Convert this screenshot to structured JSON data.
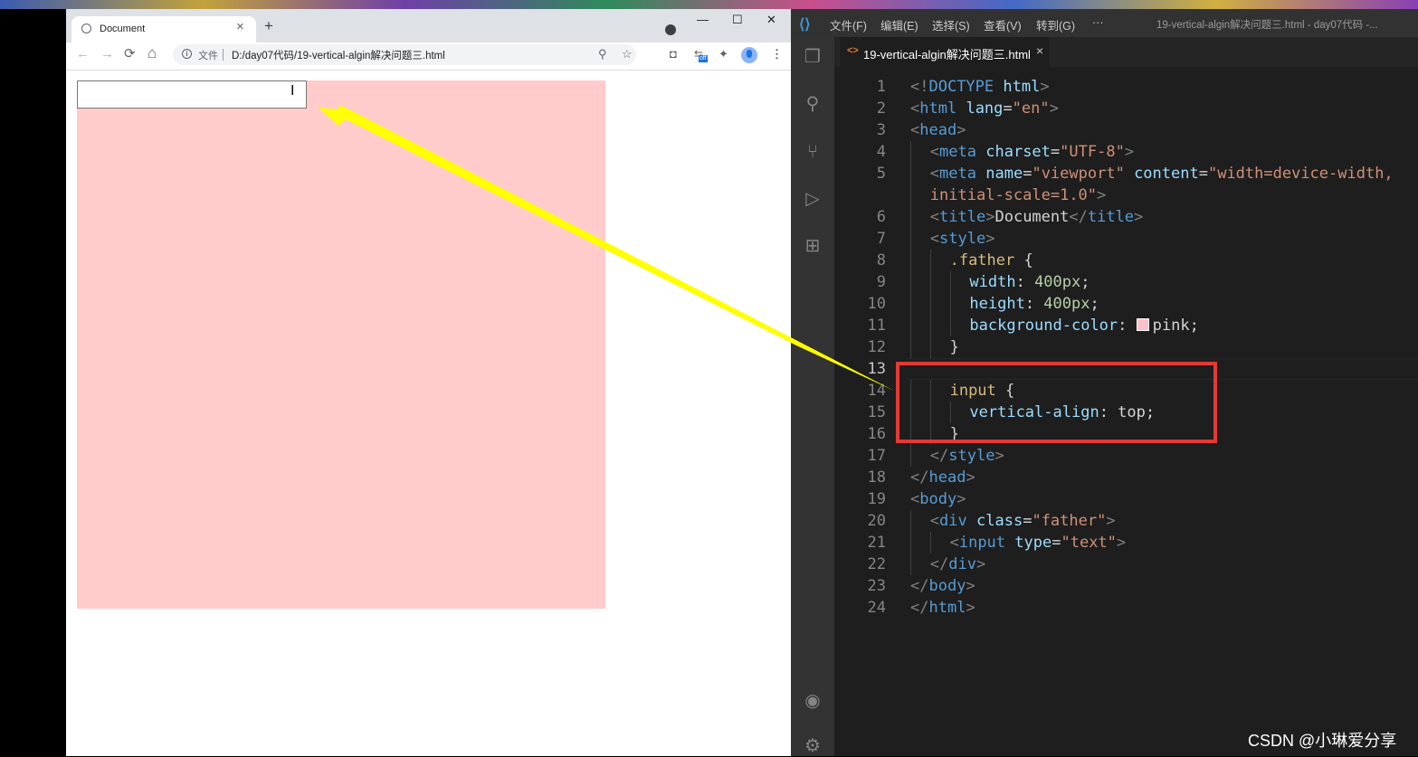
{
  "browser": {
    "tab_title": "Document",
    "tab_close": "×",
    "new_tab": "+",
    "minimize": "—",
    "maximize": "☐",
    "close": "✕",
    "back": "←",
    "forward": "→",
    "reload": "⟳",
    "home": "⌂",
    "info": "i",
    "file_label": "文件",
    "url": "D:/day07代码/19-vertical-algin解决问题三.html",
    "ext_off_badge": "off",
    "menu": "⋮",
    "page": {
      "father_color": "#ffcccb",
      "input_value": "",
      "cursor": "I"
    }
  },
  "vscode": {
    "menu": [
      "文件(F)",
      "编辑(E)",
      "选择(S)",
      "查看(V)",
      "转到(G)",
      "···"
    ],
    "window_title": "19-vertical-algin解决问题三.html - day07代码 -...",
    "tab_title": "19-vertical-algin解决问题三.html",
    "tab_icon": "<>",
    "tab_close": "×",
    "active_line": 13,
    "lines": [
      {
        "n": "1",
        "indent": 0,
        "tokens": [
          [
            "br",
            "<!"
          ],
          [
            "tag",
            "DOCTYPE"
          ],
          [
            "txt",
            " "
          ],
          [
            "attr",
            "html"
          ],
          [
            "br",
            ">"
          ]
        ]
      },
      {
        "n": "2",
        "indent": 0,
        "tokens": [
          [
            "br",
            "<"
          ],
          [
            "tag",
            "html"
          ],
          [
            "txt",
            " "
          ],
          [
            "attr",
            "lang"
          ],
          [
            "txt",
            "="
          ],
          [
            "str",
            "\"en\""
          ],
          [
            "br",
            ">"
          ]
        ]
      },
      {
        "n": "3",
        "indent": 0,
        "tokens": [
          [
            "br",
            "<"
          ],
          [
            "tag",
            "head"
          ],
          [
            "br",
            ">"
          ]
        ]
      },
      {
        "n": "4",
        "indent": 1,
        "tokens": [
          [
            "br",
            "<"
          ],
          [
            "tag",
            "meta"
          ],
          [
            "txt",
            " "
          ],
          [
            "attr",
            "charset"
          ],
          [
            "txt",
            "="
          ],
          [
            "str",
            "\"UTF-8\""
          ],
          [
            "br",
            ">"
          ]
        ]
      },
      {
        "n": "5",
        "indent": 1,
        "tokens": [
          [
            "br",
            "<"
          ],
          [
            "tag",
            "meta"
          ],
          [
            "txt",
            " "
          ],
          [
            "attr",
            "name"
          ],
          [
            "txt",
            "="
          ],
          [
            "str",
            "\"viewport\""
          ],
          [
            "txt",
            " "
          ],
          [
            "attr",
            "content"
          ],
          [
            "txt",
            "="
          ],
          [
            "str",
            "\"width=device-width,"
          ]
        ]
      },
      {
        "n": "",
        "indent": 1,
        "tokens": [
          [
            "str",
            "initial-scale=1.0\""
          ],
          [
            "br",
            ">"
          ]
        ]
      },
      {
        "n": "6",
        "indent": 1,
        "tokens": [
          [
            "br",
            "<"
          ],
          [
            "tag",
            "title"
          ],
          [
            "br",
            ">"
          ],
          [
            "txt",
            "Document"
          ],
          [
            "br",
            "</"
          ],
          [
            "tag",
            "title"
          ],
          [
            "br",
            ">"
          ]
        ]
      },
      {
        "n": "7",
        "indent": 1,
        "tokens": [
          [
            "br",
            "<"
          ],
          [
            "tag",
            "style"
          ],
          [
            "br",
            ">"
          ]
        ]
      },
      {
        "n": "8",
        "indent": 2,
        "tokens": [
          [
            "sel",
            ".father"
          ],
          [
            "txt",
            " {"
          ]
        ]
      },
      {
        "n": "9",
        "indent": 3,
        "tokens": [
          [
            "attr",
            "width"
          ],
          [
            "txt",
            ": "
          ],
          [
            "num",
            "400px"
          ],
          [
            "txt",
            ";"
          ]
        ]
      },
      {
        "n": "10",
        "indent": 3,
        "tokens": [
          [
            "attr",
            "height"
          ],
          [
            "txt",
            ": "
          ],
          [
            "num",
            "400px"
          ],
          [
            "txt",
            ";"
          ]
        ]
      },
      {
        "n": "11",
        "indent": 3,
        "tokens": [
          [
            "attr",
            "background-color"
          ],
          [
            "txt",
            ": "
          ],
          [
            "swatch",
            ""
          ],
          [
            "txt",
            "pink;"
          ]
        ]
      },
      {
        "n": "12",
        "indent": 2,
        "tokens": [
          [
            "txt",
            "}"
          ]
        ]
      },
      {
        "n": "13",
        "indent": 0,
        "tokens": []
      },
      {
        "n": "14",
        "indent": 2,
        "tokens": [
          [
            "sel",
            "input"
          ],
          [
            "txt",
            " {"
          ]
        ]
      },
      {
        "n": "15",
        "indent": 3,
        "tokens": [
          [
            "attr",
            "vertical-align"
          ],
          [
            "txt",
            ": top;"
          ]
        ]
      },
      {
        "n": "16",
        "indent": 2,
        "tokens": [
          [
            "txt",
            "}"
          ]
        ]
      },
      {
        "n": "17",
        "indent": 1,
        "tokens": [
          [
            "br",
            "</"
          ],
          [
            "tag",
            "style"
          ],
          [
            "br",
            ">"
          ]
        ]
      },
      {
        "n": "18",
        "indent": 0,
        "tokens": [
          [
            "br",
            "</"
          ],
          [
            "tag",
            "head"
          ],
          [
            "br",
            ">"
          ]
        ]
      },
      {
        "n": "19",
        "indent": 0,
        "tokens": [
          [
            "br",
            "<"
          ],
          [
            "tag",
            "body"
          ],
          [
            "br",
            ">"
          ]
        ]
      },
      {
        "n": "20",
        "indent": 1,
        "tokens": [
          [
            "br",
            "<"
          ],
          [
            "tag",
            "div"
          ],
          [
            "txt",
            " "
          ],
          [
            "attr",
            "class"
          ],
          [
            "txt",
            "="
          ],
          [
            "str",
            "\"father\""
          ],
          [
            "br",
            ">"
          ]
        ]
      },
      {
        "n": "21",
        "indent": 2,
        "tokens": [
          [
            "br",
            "<"
          ],
          [
            "tag",
            "input"
          ],
          [
            "txt",
            " "
          ],
          [
            "attr",
            "type"
          ],
          [
            "txt",
            "="
          ],
          [
            "str",
            "\"text\""
          ],
          [
            "br",
            ">"
          ]
        ]
      },
      {
        "n": "22",
        "indent": 1,
        "tokens": [
          [
            "br",
            "</"
          ],
          [
            "tag",
            "div"
          ],
          [
            "br",
            ">"
          ]
        ]
      },
      {
        "n": "23",
        "indent": 0,
        "tokens": [
          [
            "br",
            "</"
          ],
          [
            "tag",
            "body"
          ],
          [
            "br",
            ">"
          ]
        ]
      },
      {
        "n": "24",
        "indent": 0,
        "tokens": [
          [
            "br",
            "</"
          ],
          [
            "tag",
            "html"
          ],
          [
            "br",
            ">"
          ]
        ]
      }
    ]
  },
  "annotations": {
    "arrow_color": "#ffff00",
    "box_color": "#e53935"
  },
  "watermark": "CSDN @小琳爱分享"
}
